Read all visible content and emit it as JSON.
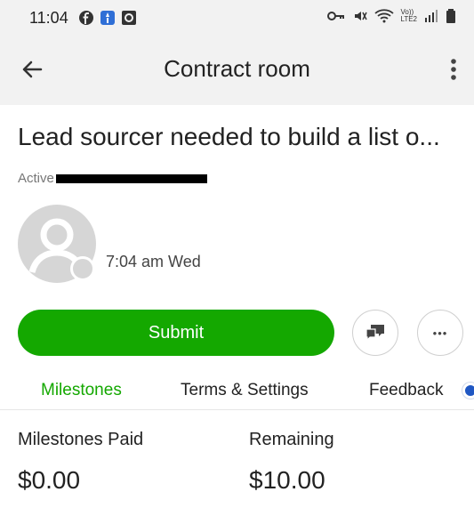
{
  "status_bar": {
    "time": "11:04",
    "left_icons": [
      "facebook-icon",
      "app-notification-icon",
      "square-app-icon"
    ],
    "right_icons": [
      "key-icon",
      "mute-icon",
      "wifi-icon",
      "volte-icon",
      "signal-icon",
      "battery-icon"
    ],
    "volte_label": "Vo))",
    "lte_label": "LTE2"
  },
  "app_bar": {
    "title": "Contract room"
  },
  "contract": {
    "title": "Lead sourcer needed to build a list o...",
    "active_label": "Active",
    "time": "7:04 am Wed"
  },
  "actions": {
    "submit_label": "Submit",
    "more_glyph": "•••"
  },
  "tabs": [
    {
      "label": "Milestones",
      "active": true
    },
    {
      "label": "Terms & Settings",
      "active": false
    },
    {
      "label": "Feedback",
      "active": false
    }
  ],
  "summary": {
    "paid_label": "Milestones Paid",
    "paid_value": "$0.00",
    "remaining_label": "Remaining",
    "remaining_value": "$10.00"
  },
  "colors": {
    "accent_green": "#14a800",
    "tab_indicator_blue": "#1f57c3",
    "avatar_gray": "#d6d6d6"
  }
}
